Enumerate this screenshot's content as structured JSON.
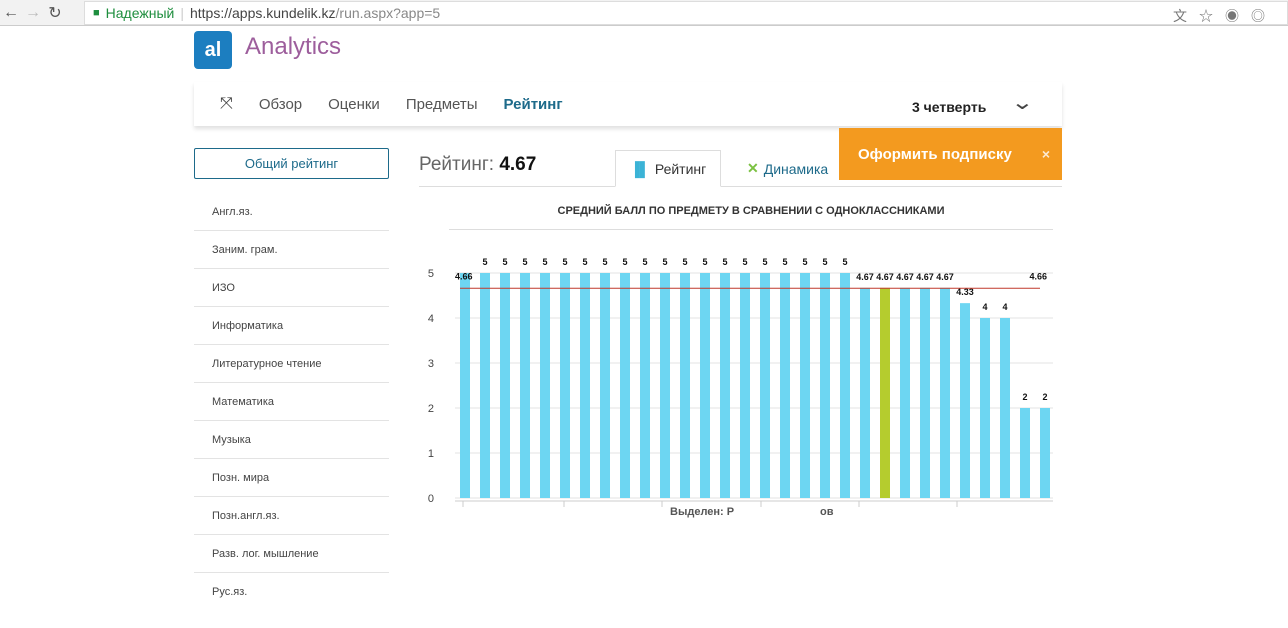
{
  "browser": {
    "secure_label": "Надежный",
    "url_host": "https://apps.kundelik.kz",
    "url_path": "/run.aspx?app=5"
  },
  "app": {
    "logo": "al",
    "title": "Analytics"
  },
  "menu": {
    "items": [
      "Обзор",
      "Оценки",
      "Предметы",
      "Рейтинг"
    ],
    "active": "Рейтинг"
  },
  "quarter": "3 четверть",
  "promo": {
    "label": "Оформить подписку",
    "close": "×"
  },
  "sidebar": {
    "all_button": "Общий рейтинг",
    "subjects": [
      "Англ.яз.",
      "Заним. грам.",
      "ИЗО",
      "Информатика",
      "Литературное чтение",
      "Математика",
      "Музыка",
      "Позн. мира",
      "Позн.англ.яз.",
      "Разв. лог. мышление",
      "Рус.яз."
    ]
  },
  "rating": {
    "label": "Рейтинг:",
    "value": "4.67"
  },
  "tabs": [
    "Рейтинг",
    "Динамика"
  ],
  "colors": {
    "bar": "#6dd6f2",
    "highlight": "#b5cc2e",
    "average_line": "#c0392b",
    "accent": "#1d6a8a",
    "promo": "#f39a1f"
  },
  "chart_data": {
    "type": "bar",
    "title": "СРЕДНИЙ БАЛЛ ПО ПРЕДМЕТУ В СРАВНЕНИИ С ОДНОКЛАССНИКАМИ",
    "values": [
      5,
      5,
      5,
      5,
      5,
      5,
      5,
      5,
      5,
      5,
      5,
      5,
      5,
      5,
      5,
      5,
      5,
      5,
      5,
      5,
      4.67,
      4.67,
      4.67,
      4.67,
      4.67,
      4.33,
      4,
      4,
      2,
      2
    ],
    "data_labels": [
      "",
      "5",
      "5",
      "5",
      "5",
      "5",
      "5",
      "5",
      "5",
      "5",
      "5",
      "5",
      "5",
      "5",
      "5",
      "5",
      "5",
      "5",
      "5",
      "5",
      "4.67",
      "4.67",
      "4.67",
      "4.67",
      "4.67",
      "4.33",
      "4",
      "4",
      "2",
      "2"
    ],
    "highlighted_index": 21,
    "average": 4.66,
    "average_label": "4.66",
    "ylim": [
      0,
      5
    ],
    "yticks": [
      0,
      1,
      2,
      3,
      4,
      5
    ],
    "xlabel_parts": [
      "Выделен: Р",
      "ов"
    ],
    "grid": true
  }
}
